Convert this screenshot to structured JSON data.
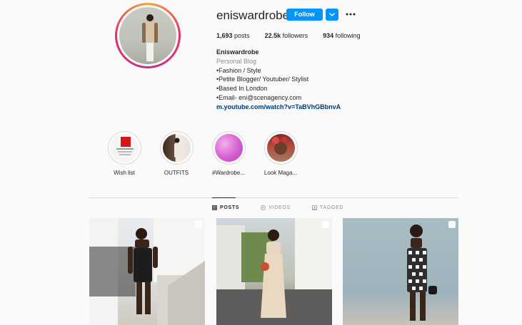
{
  "profile": {
    "username": "eniswardrobe",
    "follow_label": "Follow",
    "more_icon": "more-horizontal-icon",
    "stats": {
      "posts": "1,693",
      "posts_label": "posts",
      "followers": "22.5k",
      "followers_label": "followers",
      "following": "934",
      "following_label": "following"
    },
    "bio": {
      "name": "Eniswardrobe",
      "category": "Personal Blog",
      "lines": [
        "•Fashion / Style",
        "•Petite Blogger/ Youtuber/ Stylist",
        "•Based In London",
        "•Email- eni@scenagency.com"
      ],
      "link": "m.youtube.com/watch?v=TaBVhGBbnvA"
    }
  },
  "highlights": [
    {
      "label": "Wish list"
    },
    {
      "label": "OUTFITS"
    },
    {
      "label": "#Wardrobe..."
    },
    {
      "label": "Look Maga..."
    }
  ],
  "tabs": [
    {
      "label": "POSTS",
      "icon": "grid-icon",
      "active": true
    },
    {
      "label": "VIDEOS",
      "icon": "video-icon",
      "active": false
    },
    {
      "label": "TAGGED",
      "icon": "tag-icon",
      "active": false
    }
  ],
  "colors": {
    "accent": "#0095f6",
    "link": "#00376b",
    "muted": "#8e8e8e"
  }
}
